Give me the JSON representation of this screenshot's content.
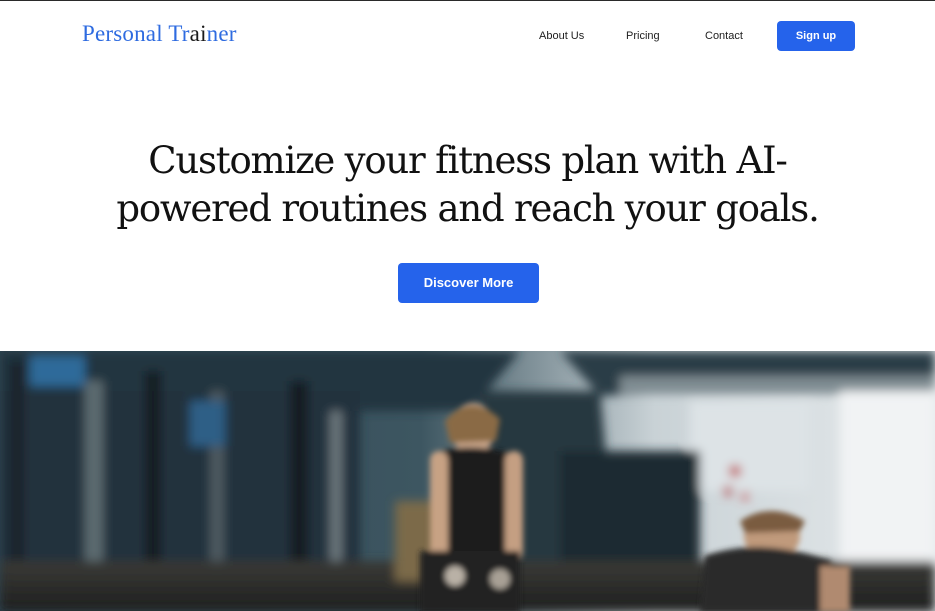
{
  "header": {
    "logo": {
      "part1": "Personal Tr",
      "part2": "ai",
      "part3": "ner"
    },
    "nav": [
      {
        "label": "About Us"
      },
      {
        "label": "Pricing"
      },
      {
        "label": "Contact"
      }
    ],
    "signup_label": "Sign up"
  },
  "hero": {
    "headline_line1": "Customize your fitness plan with AI-",
    "headline_line2": "powered routines and reach your goals.",
    "cta_label": "Discover More"
  },
  "colors": {
    "accent": "#2563eb",
    "logo": "#2e6be0",
    "text": "#111111"
  },
  "hero_image": {
    "subject": "blurred gym photo with people exercising"
  }
}
